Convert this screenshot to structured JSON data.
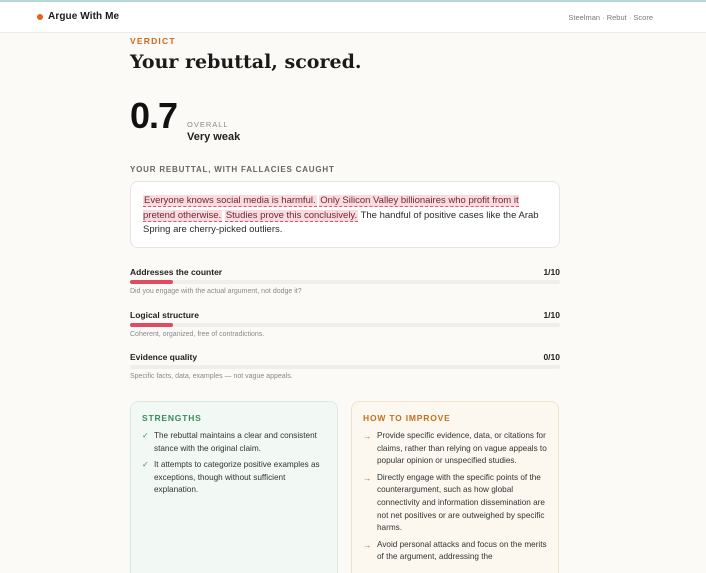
{
  "header": {
    "brand": "Argue With Me",
    "nav": "Steelman · Rebut · Score",
    "brand_color": "#e0651b"
  },
  "verdict": {
    "eyebrow": "VERDICT",
    "title": "Your rebuttal, scored.",
    "overall_score": "0.7",
    "overall_label": "OVERALL",
    "overall_rating": "Very weak"
  },
  "rebuttal": {
    "label": "YOUR REBUTTAL, WITH FALLACIES CAUGHT",
    "segments": [
      {
        "text": "Everyone knows social media is harmful.",
        "fallacy": true
      },
      {
        "text": "Only Silicon Valley billionaires who profit from it pretend otherwise.",
        "fallacy": true
      },
      {
        "text": "Studies prove this conclusively.",
        "fallacy": true
      },
      {
        "text": "The handful of positive cases like the Arab Spring are cherry-picked outliers.",
        "fallacy": false
      }
    ]
  },
  "metrics": [
    {
      "name": "Addresses the counter",
      "score_text": "1/10",
      "score": 1,
      "max": 10,
      "description": "Did you engage with the actual argument, not dodge it?"
    },
    {
      "name": "Logical structure",
      "score_text": "1/10",
      "score": 1,
      "max": 10,
      "description": "Coherent, organized, free of contradictions."
    },
    {
      "name": "Evidence quality",
      "score_text": "0/10",
      "score": 0,
      "max": 10,
      "description": "Specific facts, data, examples — not vague appeals."
    }
  ],
  "strengths": {
    "title": "STRENGTHS",
    "icon": "check-icon",
    "items": [
      "The rebuttal maintains a clear and consistent stance with the original claim.",
      "It attempts to categorize positive examples as exceptions, though without sufficient explanation."
    ]
  },
  "improve": {
    "title": "HOW TO IMPROVE",
    "icon": "arrow-right-icon",
    "items": [
      "Provide specific evidence, data, or citations for claims, rather than relying on vague appeals to popular opinion or unspecified studies.",
      "Directly engage with the specific points of the counterargument, such as how global connectivity and information dissemination are not net positives or are outweighed by specific harms.",
      "Avoid personal attacks and focus on the merits of the argument, addressing the"
    ]
  },
  "colors": {
    "accent": "#d4661f",
    "fallacy_highlight": "#f7dce0",
    "bar_fill": "#e04b61",
    "strength_green": "#3a8a5c"
  }
}
